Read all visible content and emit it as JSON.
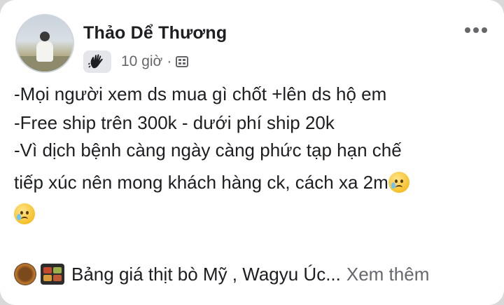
{
  "post": {
    "author_name": "Thảo Dể Thương",
    "time": "10 giờ",
    "separator": "·",
    "lines": [
      "-Mọi người xem ds mua gì chốt +lên ds hộ em",
      "-Free ship trên 300k - dưới phí ship 20k",
      "-Vì dịch bệnh càng ngày càng phức tạp hạn chế",
      "tiếp xúc nên mong khách hàng ck, cách xa 2m"
    ]
  },
  "shared": {
    "title": "Bảng giá thịt bò Mỹ , Wagyu Úc...",
    "see_more_label": "Xem thêm"
  },
  "icons": {
    "badge": "raised-hand-icon",
    "privacy": "friends-list-icon",
    "options": "more-options-icon",
    "emoji": "sad-sweat-emoji"
  },
  "colors": {
    "text": "#1c1e21",
    "secondary": "#65676b",
    "badge_bg": "#e4e6eb"
  }
}
